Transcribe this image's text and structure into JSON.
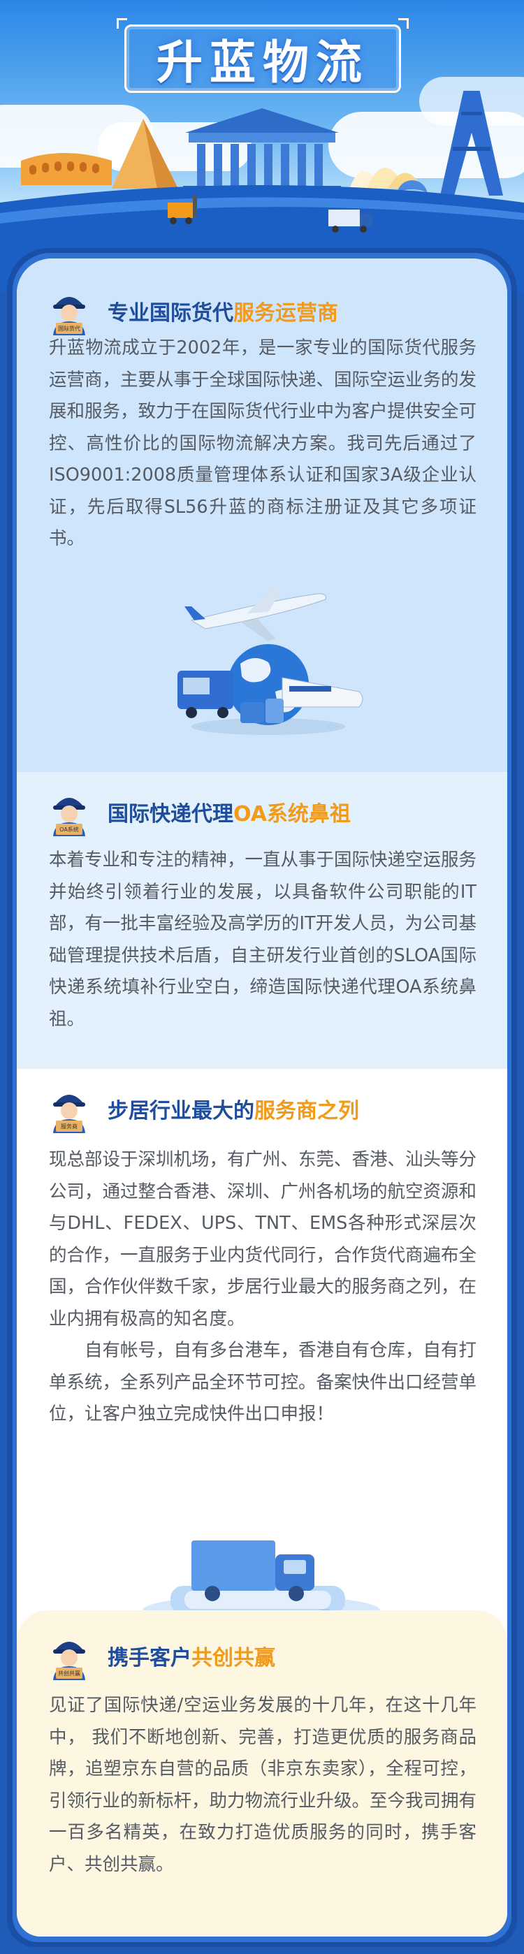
{
  "header": {
    "title": "升蓝物流"
  },
  "sections": [
    {
      "badge": "国际货代",
      "title_main": "专业国际货代",
      "title_highlight": "服务运营商",
      "paragraphs": [
        "升蓝物流成立于2002年，是一家专业的国际货代服务运营商，主要从事于全球国际快递、国际空运业务的发展和服务，致力于在国际货代行业中为客户提供安全可控、高性价比的国际物流解决方案。我司先后通过了ISO9001:2008质量管理体系认证和国家3A级企业认证，先后取得SL56升蓝的商标注册证及其它多项证书。"
      ]
    },
    {
      "badge": "OA系统",
      "title_main": "国际快递代理",
      "title_highlight": "OA系统鼻祖",
      "paragraphs": [
        "本着专业和专注的精神，一直从事于国际快递空运服务并始终引领着行业的发展，以具备软件公司职能的IT部，有一批丰富经验及高学历的IT开发人员，为公司基础管理提供技术后盾，自主研发行业首创的SLOA国际快递系统填补行业空白，缔造国际快递代理OA系统鼻祖。"
      ]
    },
    {
      "badge": "服务商",
      "title_main": "步居行业最大的",
      "title_highlight": "服务商之列",
      "paragraphs": [
        "现总部设于深圳机场，有广州、东莞、香港、汕头等分公司，通过整合香港、深圳、广州各机场的航空资源和与DHL、FEDEX、UPS、TNT、EMS各种形式深层次的合作，一直服务于业内货代同行，合作货代商遍布全国，合作伙伴数千家，步居行业最大的服务商之列，在业内拥有极高的知名度。",
        "自有帐号，自有多台港车，香港自有仓库，自有打单系统，全系列产品全环节可控。备案快件出口经营单位，让客户独立完成快件出口申报！"
      ]
    },
    {
      "badge": "共创共赢",
      "title_main": "携手客户",
      "title_highlight": "共创共赢",
      "paragraphs": [
        "见证了国际快递/空运业务发展的十几年，在这十几年中， 我们不断地创新、完善，打造更优质的服务商品牌，追塑京东自营的品质（非京东卖家），全程可控，引领行业的新标杆，助力物流行业升级。至今我司拥有一百多名精英，在致力打造优质服务的同时，携手客户、共创共赢。"
      ]
    }
  ],
  "colors": {
    "title_blue": "#1d4d9c",
    "highlight_orange": "#f29a1a",
    "body_text": "#555a63",
    "frame_blue": "#1a4fa8"
  }
}
